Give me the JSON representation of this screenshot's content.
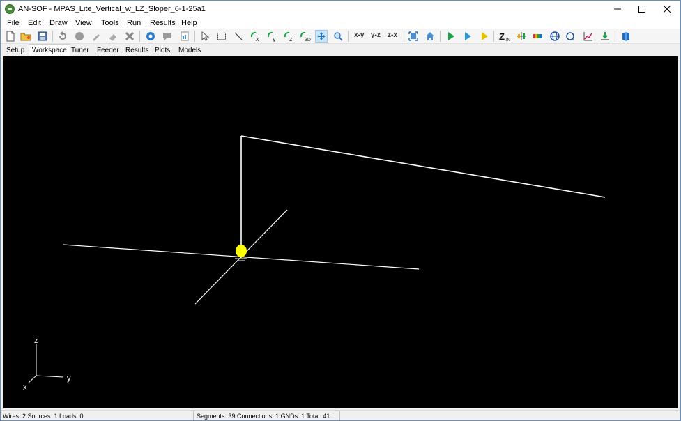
{
  "window": {
    "title": "AN-SOF - MPAS_Lite_Vertical_w_LZ_Sloper_6-1-25a1"
  },
  "menu": [
    "File",
    "Edit",
    "Draw",
    "View",
    "Tools",
    "Run",
    "Results",
    "Help"
  ],
  "toolbar": {
    "view_xy": "x-y",
    "view_yz": "y-z",
    "view_zx": "z-x",
    "active_tool": "pan"
  },
  "tabs": [
    "Setup",
    "Workspace",
    "Tuner",
    "Feeder",
    "Results",
    "Plots",
    "Models"
  ],
  "active_tab": "Workspace",
  "viewport": {
    "background": "#000000",
    "wire_color": "#ffffff",
    "source_color": "#ffff00",
    "axis_labels": {
      "z": "z",
      "y": "y",
      "x": "x"
    }
  },
  "status": {
    "left": "Wires: 2  Sources: 1  Loads: 0",
    "right": "Segments: 39  Connections: 1  GNDs: 1  Total: 41"
  },
  "colors": {
    "accent_green": "#1aa34a",
    "accent_blue": "#1e6fc2",
    "active_button_bg": "#cce4f7"
  }
}
